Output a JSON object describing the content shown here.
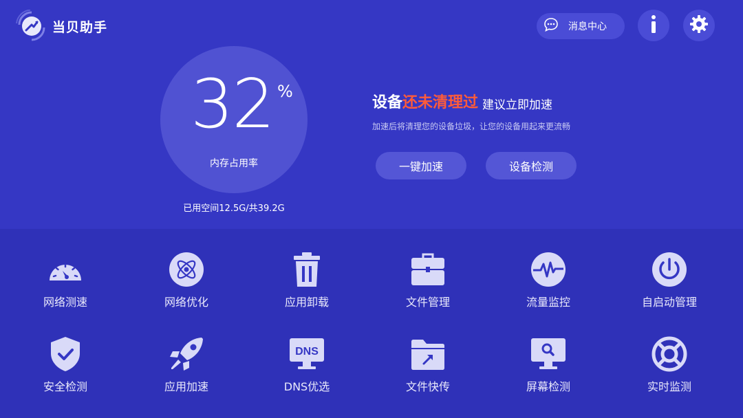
{
  "colors": {
    "background_top": "#3537c4",
    "background_bottom": "#2f31b8",
    "accent_red": "#ff5b3a",
    "icon_light": "#d9daf8"
  },
  "header": {
    "app_title": "当贝助手",
    "logo_icon": "rocket-launch-icon",
    "message_center_label": "消息中心",
    "message_icon": "chat-bubble-icon",
    "info_icon": "info-icon",
    "settings_icon": "gear-icon"
  },
  "memory": {
    "value": "32",
    "unit": "%",
    "caption": "内存占用率",
    "storage_text": "已用空间12.5G/共39.2G"
  },
  "status": {
    "title_prefix": "设备",
    "title_highlight": "还未清理过",
    "title_suffix": "建议立即加速",
    "description": "加速后将清理您的设备垃圾，让您的设备用起来更流畅"
  },
  "actions": {
    "speedup_label": "一键加速",
    "detect_label": "设备检测"
  },
  "tools": [
    {
      "label": "网络测速",
      "icon": "speedometer-icon"
    },
    {
      "label": "网络优化",
      "icon": "atom-icon"
    },
    {
      "label": "应用卸载",
      "icon": "trash-icon"
    },
    {
      "label": "文件管理",
      "icon": "briefcase-icon"
    },
    {
      "label": "流量监控",
      "icon": "pulse-icon"
    },
    {
      "label": "自启动管理",
      "icon": "power-icon"
    },
    {
      "label": "安全检测",
      "icon": "shield-check-icon"
    },
    {
      "label": "应用加速",
      "icon": "rocket-icon"
    },
    {
      "label": "DNS优选",
      "icon": "dns-monitor-icon"
    },
    {
      "label": "文件快传",
      "icon": "folder-send-icon"
    },
    {
      "label": "屏幕检测",
      "icon": "monitor-search-icon"
    },
    {
      "label": "实时监测",
      "icon": "lifebuoy-icon"
    }
  ]
}
